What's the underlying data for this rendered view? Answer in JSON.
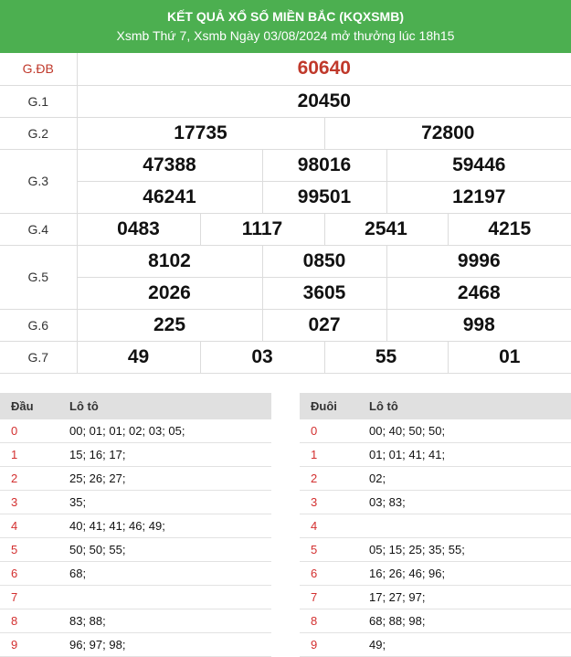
{
  "header": {
    "title": "KẾT QUẢ XỔ SỐ MIỀN BẮC (KQXSMB)",
    "subtitle": "Xsmb Thứ 7, Xsmb Ngày 03/08/2024 mở thưởng lúc 18h15"
  },
  "prizes": [
    {
      "label": "G.ĐB",
      "numbers": [
        "60640"
      ]
    },
    {
      "label": "G.1",
      "numbers": [
        "20450"
      ]
    },
    {
      "label": "G.2",
      "numbers": [
        "17735",
        "72800"
      ]
    },
    {
      "label": "G.3",
      "numbers": [
        "47388",
        "98016",
        "59446",
        "46241",
        "99501",
        "12197"
      ]
    },
    {
      "label": "G.4",
      "numbers": [
        "0483",
        "1117",
        "2541",
        "4215"
      ]
    },
    {
      "label": "G.5",
      "numbers": [
        "8102",
        "0850",
        "9996",
        "2026",
        "3605",
        "2468"
      ]
    },
    {
      "label": "G.6",
      "numbers": [
        "225",
        "027",
        "998"
      ]
    },
    {
      "label": "G.7",
      "numbers": [
        "49",
        "03",
        "55",
        "01"
      ]
    }
  ],
  "loto_head": {
    "col1": "Đầu",
    "col2": "Lô tô",
    "rows": [
      {
        "k": "0",
        "v": "00; 01; 01; 02; 03; 05;"
      },
      {
        "k": "1",
        "v": "15; 16; 17;"
      },
      {
        "k": "2",
        "v": "25; 26; 27;"
      },
      {
        "k": "3",
        "v": "35;"
      },
      {
        "k": "4",
        "v": "40; 41; 41; 46; 49;"
      },
      {
        "k": "5",
        "v": "50; 50; 55;"
      },
      {
        "k": "6",
        "v": "68;"
      },
      {
        "k": "7",
        "v": ""
      },
      {
        "k": "8",
        "v": "83; 88;"
      },
      {
        "k": "9",
        "v": "96; 97; 98;"
      }
    ]
  },
  "loto_tail": {
    "col1": "Đuôi",
    "col2": "Lô tô",
    "rows": [
      {
        "k": "0",
        "v": "00; 40; 50; 50;"
      },
      {
        "k": "1",
        "v": "01; 01; 41; 41;"
      },
      {
        "k": "2",
        "v": "02;"
      },
      {
        "k": "3",
        "v": "03; 83;"
      },
      {
        "k": "4",
        "v": ""
      },
      {
        "k": "5",
        "v": "05; 15; 25; 35; 55;"
      },
      {
        "k": "6",
        "v": "16; 26; 46; 96;"
      },
      {
        "k": "7",
        "v": "17; 27; 97;"
      },
      {
        "k": "8",
        "v": "68; 88; 98;"
      },
      {
        "k": "9",
        "v": "49;"
      }
    ]
  },
  "colors": {
    "header_bg": "#4caf50",
    "special_prize": "#c0392b",
    "loto_key": "#d32f2f"
  }
}
